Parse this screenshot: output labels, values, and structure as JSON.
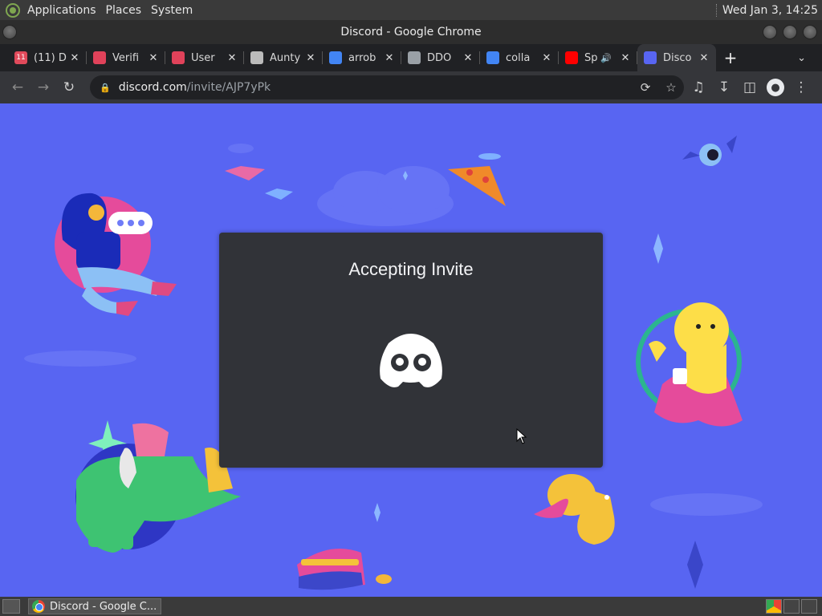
{
  "top_panel": {
    "menus": [
      "Applications",
      "Places",
      "System"
    ],
    "clock": "Wed Jan  3, 14:25"
  },
  "window": {
    "title": "Discord - Google Chrome"
  },
  "tabs": [
    {
      "label": "(11) D",
      "icon": "calendar-icon",
      "color": "#e04a5b",
      "badge": "11"
    },
    {
      "label": "Verifi",
      "icon": "robot-icon",
      "color": "#e0425a"
    },
    {
      "label": "User",
      "icon": "robot-icon",
      "color": "#e0425a"
    },
    {
      "label": "Aunty",
      "icon": "roblox-icon",
      "color": "#bbbbbb"
    },
    {
      "label": "arrob",
      "icon": "google-icon",
      "color": "#4285f4"
    },
    {
      "label": "DDO",
      "icon": "globe-icon",
      "color": "#9aa0a6"
    },
    {
      "label": "colla",
      "icon": "google-icon",
      "color": "#4285f4"
    },
    {
      "label": "Sp",
      "icon": "youtube-icon",
      "color": "#ff0000",
      "audio": true
    },
    {
      "label": "Disco",
      "icon": "discord-icon",
      "color": "#5865f2",
      "active": true
    }
  ],
  "toolbar": {
    "url_host": "discord.com",
    "url_path": "/invite/AJP7yPk"
  },
  "modal": {
    "title": "Accepting Invite"
  },
  "taskbar": {
    "task_label": "Discord - Google C..."
  },
  "colors": {
    "discord_blurple": "#5865f2",
    "modal_bg": "#313338"
  }
}
